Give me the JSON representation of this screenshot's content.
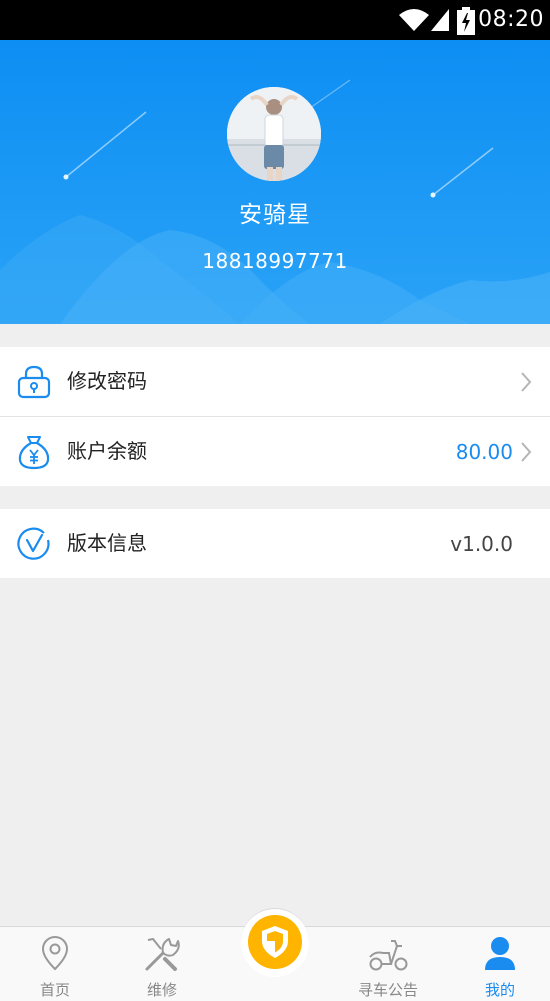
{
  "status_bar": {
    "time": "08:20"
  },
  "profile": {
    "name": "安骑星",
    "phone": "18818997771"
  },
  "menu": {
    "change_password": {
      "label": "修改密码",
      "icon": "lock-icon"
    },
    "balance": {
      "label": "账户余额",
      "value": "80.00",
      "icon": "money-bag-icon"
    },
    "version": {
      "label": "版本信息",
      "value": "v1.0.0",
      "icon": "version-check-icon"
    }
  },
  "tabs": [
    {
      "label": "首页",
      "icon": "location-pin-icon",
      "active": false
    },
    {
      "label": "维修",
      "icon": "tools-icon",
      "active": false
    },
    {
      "label": "",
      "icon": "shield-icon",
      "active": false
    },
    {
      "label": "寻车公告",
      "icon": "scooter-icon",
      "active": false
    },
    {
      "label": "我的",
      "icon": "user-icon",
      "active": true
    }
  ],
  "colors": {
    "brand_blue": "#1296f6",
    "accent_blue": "#1a8cf0",
    "center_button": "#ffb400"
  }
}
